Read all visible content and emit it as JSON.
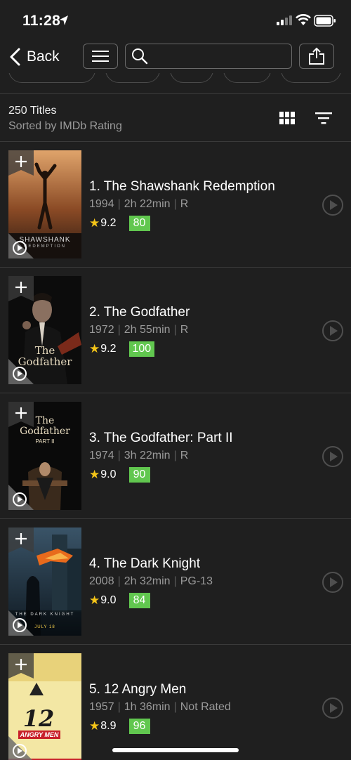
{
  "status_bar": {
    "time": "11:28",
    "location_icon": "location-arrow-icon",
    "signal_icon": "cellular-signal-icon",
    "wifi_icon": "wifi-icon",
    "battery_icon": "battery-icon"
  },
  "nav": {
    "back_label": "Back",
    "menu_icon": "hamburger-menu-icon",
    "search_icon": "search-icon",
    "search_placeholder": "",
    "share_icon": "share-icon"
  },
  "list_header": {
    "count": "250 Titles",
    "sort": "Sorted by IMDb Rating",
    "grid_icon": "grid-view-icon",
    "filter_icon": "sort-filter-icon"
  },
  "colors": {
    "background": "#1f1f1f",
    "star": "#f5c518",
    "metascore": "#61c74f",
    "secondary_text": "#9a9a9a"
  },
  "movies": [
    {
      "title": "1. The Shawshank Redemption",
      "year": "1994",
      "runtime": "2h 22min",
      "certificate": "R",
      "rating": "9.2",
      "metascore": "80",
      "poster_text": "SHAWSHANK",
      "poster_subtext": "REDEMPTION"
    },
    {
      "title": "2. The Godfather",
      "year": "1972",
      "runtime": "2h 55min",
      "certificate": "R",
      "rating": "9.2",
      "metascore": "100",
      "poster_text": "The Godfather",
      "poster_subtext": ""
    },
    {
      "title": "3. The Godfather: Part II",
      "year": "1974",
      "runtime": "3h 22min",
      "certificate": "R",
      "rating": "9.0",
      "metascore": "90",
      "poster_text": "The Godfather",
      "poster_subtext": "PART II"
    },
    {
      "title": "4. The Dark Knight",
      "year": "2008",
      "runtime": "2h 32min",
      "certificate": "PG-13",
      "rating": "9.0",
      "metascore": "84",
      "poster_text": "THE DARK KNIGHT",
      "poster_subtext": "JULY 18"
    },
    {
      "title": "5. 12 Angry Men",
      "year": "1957",
      "runtime": "1h 36min",
      "certificate": "Not Rated",
      "rating": "8.9",
      "metascore": "96",
      "poster_text": "12",
      "poster_subtext": "ANGRY MEN"
    }
  ]
}
